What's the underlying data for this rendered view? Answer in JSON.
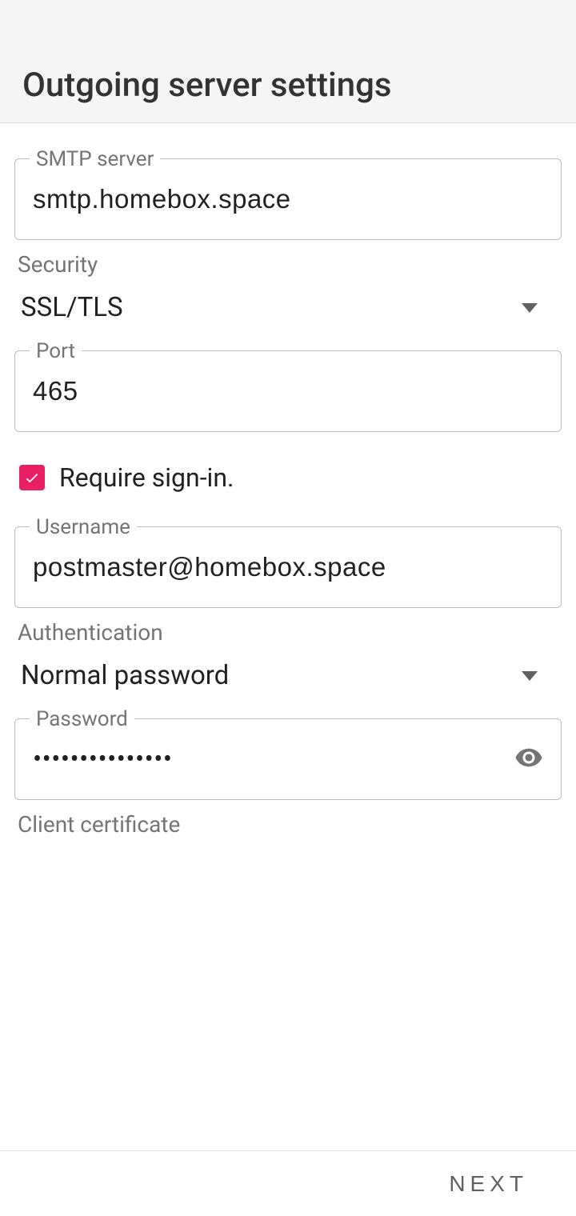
{
  "header": {
    "title": "Outgoing server settings"
  },
  "fields": {
    "smtp_label": "SMTP server",
    "smtp_value": "smtp.homebox.space",
    "security_label": "Security",
    "security_value": "SSL/TLS",
    "port_label": "Port",
    "port_value": "465",
    "require_signin_label": "Require sign-in.",
    "require_signin_checked": true,
    "username_label": "Username",
    "username_value": "postmaster@homebox.space",
    "auth_label": "Authentication",
    "auth_value": "Normal password",
    "password_label": "Password",
    "password_value": "•••••••••••••••",
    "client_cert_label": "Client certificate",
    "client_cert_value": ""
  },
  "footer": {
    "next": "NEXT"
  },
  "colors": {
    "accent": "#e91e63"
  }
}
